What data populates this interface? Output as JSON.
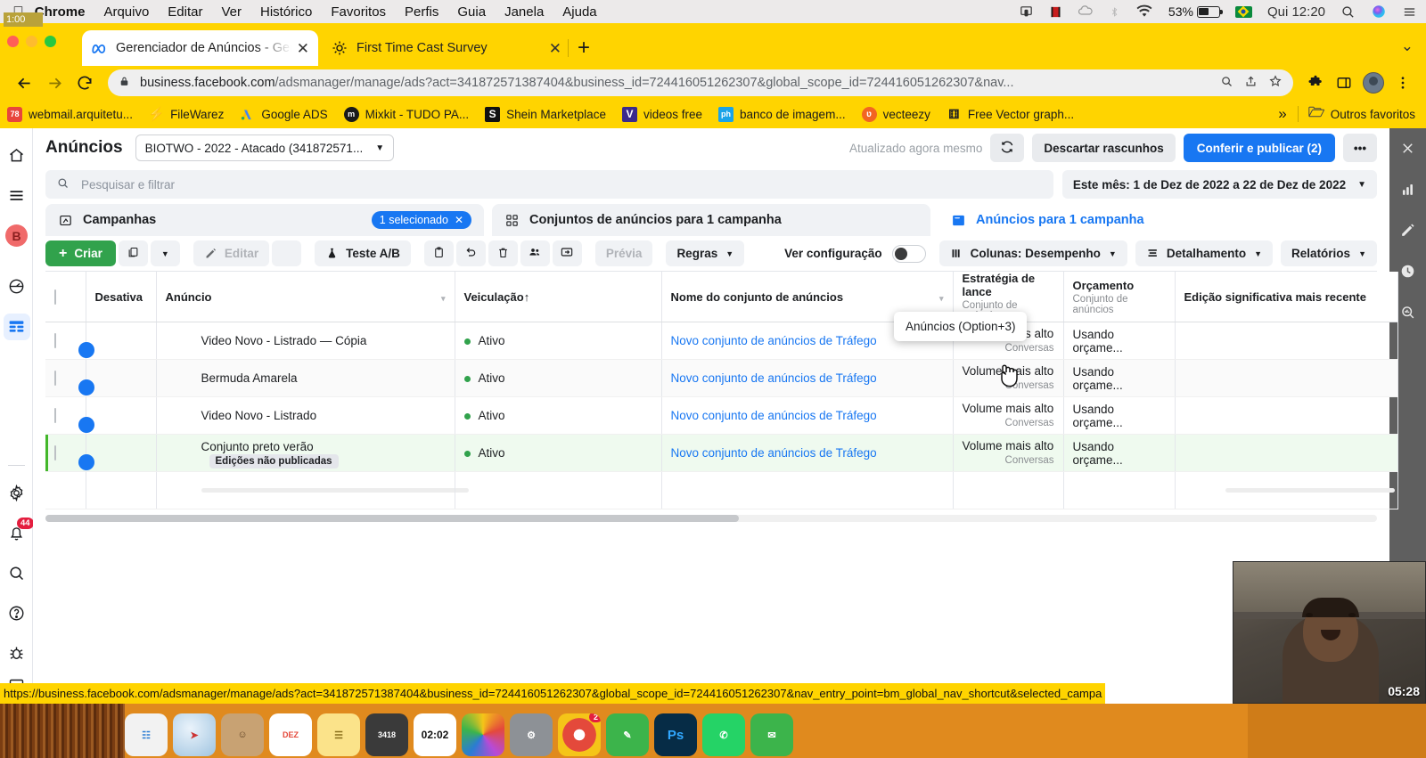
{
  "os": {
    "menu": {
      "apple_icon": "apple-icon",
      "items": [
        {
          "label": "Chrome",
          "bold": true
        },
        {
          "label": "Arquivo",
          "bold": false
        },
        {
          "label": "Editar",
          "bold": false
        },
        {
          "label": "Ver",
          "bold": false
        },
        {
          "label": "Histórico",
          "bold": false
        },
        {
          "label": "Favoritos",
          "bold": false
        },
        {
          "label": "Perfis",
          "bold": false
        },
        {
          "label": "Guia",
          "bold": false
        },
        {
          "label": "Janela",
          "bold": false
        },
        {
          "label": "Ajuda",
          "bold": false
        }
      ],
      "status": {
        "screen_mirror_icon": "airplay-icon",
        "recorder_icon": "film-strip-icon",
        "creative_cloud_icon": "creative-cloud-icon",
        "bluetooth_icon": "bluetooth-icon",
        "wifi_icon": "wifi-icon",
        "battery_percent": "53%",
        "flag_icon": "brazil-flag-icon",
        "clock": "Qui 12:20",
        "search_icon": "spotlight-search-icon",
        "siri_icon": "siri-icon",
        "controlcenter_icon": "control-center-icon"
      }
    },
    "recording_timer": "1:00",
    "dock_timer": "02:02",
    "webcam_timer": "05:28"
  },
  "browser": {
    "tabs": [
      {
        "title": "Gerenciador de Anúncios - Ger",
        "favicon": "meta-infinity-icon",
        "active": true,
        "close_label": "✕"
      },
      {
        "title": "First Time Cast Survey",
        "favicon": "gear-flower-icon",
        "active": false,
        "close_label": "✕"
      }
    ],
    "new_tab_label": "+",
    "window_chevron": "⌄",
    "nav": {
      "back_icon": "arrow-back-icon",
      "forward_icon": "arrow-forward-icon",
      "reload_icon": "reload-icon",
      "extensions_icon": "puzzle-piece-icon",
      "sidepanel_icon": "side-panel-icon",
      "profile_icon": "profile-avatar-icon",
      "menu_icon": "kebab-menu-icon"
    },
    "omnibox": {
      "lock_icon": "lock-icon",
      "host": "business.facebook.com",
      "path": "/adsmanager/manage/ads?act=341872571387404&business_id=724416051262307&global_scope_id=724416051262307&nav...",
      "zoom_icon": "zoom-search-icon",
      "share_icon": "share-icon",
      "bookmark_icon": "star-icon"
    },
    "bookmarks": [
      {
        "label": "webmail.arquitetu...",
        "icon_text": "78",
        "icon_color": "#e8453c"
      },
      {
        "label": "FileWarez",
        "icon_text": "⚡",
        "icon_color": "#f5b731"
      },
      {
        "label": "Google ADS",
        "icon_text": "A",
        "icon_color": "#4285f4"
      },
      {
        "label": "Mixkit - TUDO PA...",
        "icon_text": "m",
        "icon_color": "#1a1a1a"
      },
      {
        "label": "Shein Marketplace",
        "icon_text": "S",
        "icon_color": "#111111"
      },
      {
        "label": "videos free",
        "icon_text": "V",
        "icon_color": "#3b2a8c"
      },
      {
        "label": "banco de imagem...",
        "icon_text": "ph",
        "icon_color": "#1aa3e8"
      },
      {
        "label": "vecteezy",
        "icon_text": "ʋ",
        "icon_color": "#f26522"
      },
      {
        "label": "Free Vector graph...",
        "icon_text": "⬇",
        "icon_color": "#222222"
      }
    ],
    "bookmarks_overflow": "»",
    "other_bookmarks": {
      "label": "Outros favoritos",
      "icon": "folder-icon"
    },
    "status_url": "https://business.facebook.com/adsmanager/manage/ads?act=341872571387404&business_id=724416051262307&global_scope_id=724416051262307&nav_entry_point=bm_global_nav_shortcut&selected_campa"
  },
  "app": {
    "left_rail": [
      {
        "name": "home-icon",
        "label": "Início"
      },
      {
        "name": "hamburger-menu-icon",
        "label": "Menu"
      },
      {
        "name": "business-avatar",
        "label": "B"
      },
      {
        "name": "speedometer-icon",
        "label": "Visão geral"
      },
      {
        "name": "table-grid-icon",
        "label": "Gerenciador de Anúncios",
        "active": true
      },
      {
        "name": "gear-icon",
        "label": "Configurações"
      },
      {
        "name": "bell-icon",
        "label": "Notificações",
        "badge": "44"
      },
      {
        "name": "search-icon",
        "label": "Pesquisar"
      },
      {
        "name": "help-circle-icon",
        "label": "Ajuda"
      },
      {
        "name": "bug-icon",
        "label": "Reportar erro"
      },
      {
        "name": "report-icon",
        "label": "Relatório"
      }
    ],
    "right_rail": [
      {
        "name": "close-icon"
      },
      {
        "name": "bar-chart-icon"
      },
      {
        "name": "pencil-edit-icon"
      },
      {
        "name": "clock-history-icon"
      },
      {
        "name": "magnify-data-icon"
      }
    ],
    "header": {
      "title": "Anúncios",
      "account_select": "BIOTWO - 2022 - Atacado (341872571...",
      "account_chevron": "▼",
      "updated_text": "Atualizado agora mesmo",
      "refresh_icon": "refresh-icon",
      "discard_label": "Descartar rascunhos",
      "publish_label": "Conferir e publicar (2)",
      "more_label": "•••"
    },
    "search": {
      "placeholder": "Pesquisar e filtrar",
      "icon": "search-icon",
      "date_range": "Este mês: 1 de Dez de 2022 a 22 de Dez de 2022",
      "date_chevron": "▼"
    },
    "tooltip": "Anúncios (Option+3)",
    "level_tabs": [
      {
        "label": "Campanhas",
        "icon": "campaign-icon",
        "pill": "1 selecionado",
        "pill_close": "✕",
        "selected": false
      },
      {
        "label": "Conjuntos de anúncios para 1 campanha",
        "icon": "adset-grid-icon",
        "pill": null,
        "selected": false
      },
      {
        "label": "Anúncios para 1 campanha",
        "icon": "ads-card-icon",
        "pill": null,
        "selected": true
      }
    ],
    "toolbar": {
      "create_label": "Criar",
      "create_plus": "+",
      "duplicate_icon": "duplicate-icon",
      "duplicate_chevron": "▼",
      "edit_label": "Editar",
      "edit_icon": "pencil-icon",
      "abtest_label": "Teste A/B",
      "abtest_icon": "flask-icon",
      "clipboard_icon": "clipboard-icon",
      "undo_icon": "undo-icon",
      "trash_icon": "trash-icon",
      "audience_icon": "people-icon",
      "export_icon": "export-icon",
      "preview_label": "Prévia",
      "rules_label": "Regras",
      "rules_chevron": "▼",
      "see_config_label": "Ver configuração",
      "columns_label": "Colunas: Desempenho",
      "columns_icon": "columns-icon",
      "columns_chevron": "▼",
      "breakdown_label": "Detalhamento",
      "breakdown_icon": "breakdown-icon",
      "breakdown_chevron": "▼",
      "reports_label": "Relatórios",
      "reports_chevron": "▼"
    },
    "table": {
      "columns": [
        {
          "key": "check",
          "label": ""
        },
        {
          "key": "off",
          "label": "Desativa"
        },
        {
          "key": "ad",
          "label": "Anúncio",
          "chevron": "▾"
        },
        {
          "key": "delivery",
          "label": "Veiculação",
          "sort": "↑",
          "blue": true
        },
        {
          "key": "adset",
          "label": "Nome do conjunto de anúncios",
          "chevron": "▾"
        },
        {
          "key": "bid",
          "label": "Estratégia de lance",
          "sub": "Conjunto de anúncios"
        },
        {
          "key": "budget",
          "label": "Orçamento",
          "sub": "Conjunto de anúncios"
        },
        {
          "key": "lastedit",
          "label": "Edição significativa mais recente"
        }
      ],
      "rows": [
        {
          "ad": "Video Novo - Listrado — Cópia",
          "badge": null,
          "delivery": "Ativo",
          "adset": "Novo conjunto de anúncios de Tráfego",
          "bid": "Volume mais alto",
          "bid_sub": "Conversas",
          "budget": "Usando orçame...",
          "lastedit": "",
          "enabled": true,
          "highlight": false
        },
        {
          "ad": "Bermuda Amarela",
          "badge": null,
          "delivery": "Ativo",
          "adset": "Novo conjunto de anúncios de Tráfego",
          "bid": "Volume mais alto",
          "bid_sub": "Conversas",
          "budget": "Usando orçame...",
          "lastedit": "",
          "enabled": true,
          "highlight": false
        },
        {
          "ad": "Video Novo - Listrado",
          "badge": null,
          "delivery": "Ativo",
          "adset": "Novo conjunto de anúncios de Tráfego",
          "bid": "Volume mais alto",
          "bid_sub": "Conversas",
          "budget": "Usando orçame...",
          "lastedit": "",
          "enabled": true,
          "highlight": false
        },
        {
          "ad": "Conjunto preto verão",
          "badge": "Edições não publicadas",
          "delivery": "Ativo",
          "adset": "Novo conjunto de anúncios de Tráfego",
          "bid": "Volume mais alto",
          "bid_sub": "Conversas",
          "budget": "Usando orçame...",
          "lastedit": "",
          "enabled": true,
          "highlight": true
        }
      ]
    }
  },
  "colors": {
    "chrome_theme": "#ffd400",
    "fb_blue": "#1877f2",
    "create_green": "#31a24c",
    "active_green": "#31a24c",
    "highlight_row": "#effaef"
  }
}
